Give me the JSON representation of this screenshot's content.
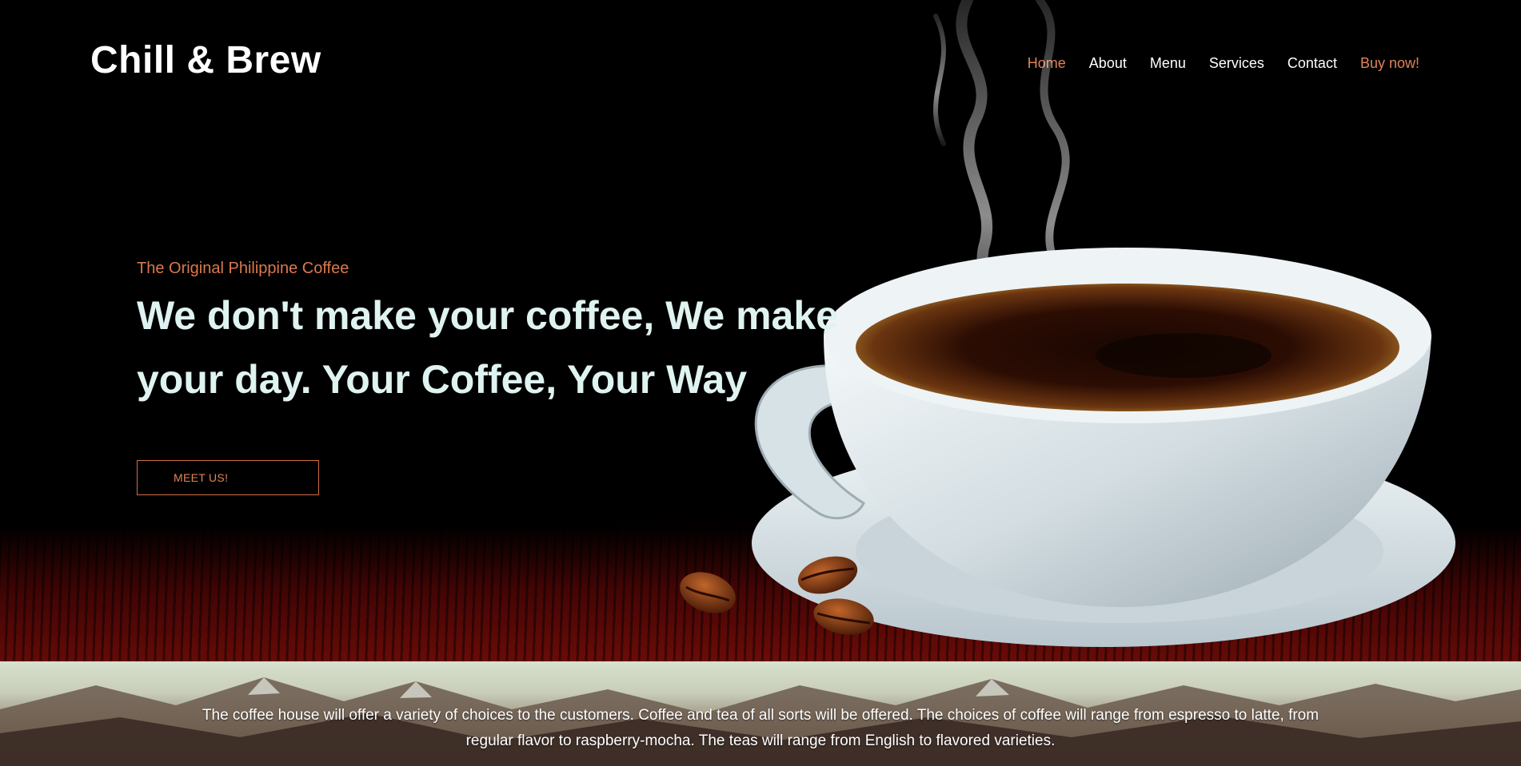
{
  "brand": {
    "name": "Chill & Brew"
  },
  "nav": {
    "items": [
      {
        "label": "Home",
        "active": true
      },
      {
        "label": "About",
        "active": false
      },
      {
        "label": "Menu",
        "active": false
      },
      {
        "label": "Services",
        "active": false
      },
      {
        "label": "Contact",
        "active": false
      },
      {
        "label": "Buy now!",
        "active": false
      }
    ]
  },
  "hero": {
    "tagline": "The Original Philippine Coffee",
    "headline": "We don't make your coffee, We make your day. Your Coffee, Your Way",
    "cta_label": "MEET US!"
  },
  "about": {
    "text": "The coffee house will offer a variety of choices to the customers. Coffee and tea of all sorts will be offered. The choices of coffee will range from espresso to latte, from regular flavor to raspberry-mocha. The teas will range from English to flavored varieties."
  },
  "colors": {
    "accent": "#e0835a",
    "headline": "#dff3f0",
    "background": "#000000"
  }
}
